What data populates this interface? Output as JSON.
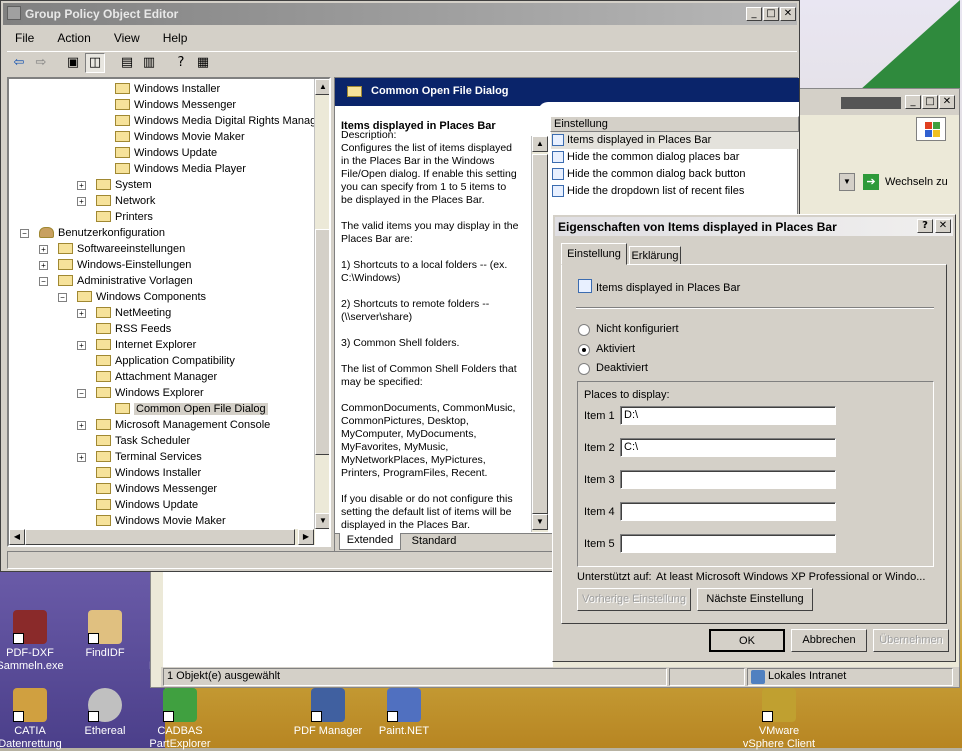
{
  "gpo_window": {
    "title": "Group Policy Object Editor",
    "menu": [
      "File",
      "Action",
      "View",
      "Help"
    ],
    "tree": [
      {
        "label": "Windows Installer",
        "indent": 4
      },
      {
        "label": "Windows Messenger",
        "indent": 4
      },
      {
        "label": "Windows Media Digital Rights Management",
        "indent": 4
      },
      {
        "label": "Windows Movie Maker",
        "indent": 4
      },
      {
        "label": "Windows Update",
        "indent": 4
      },
      {
        "label": "Windows Media Player",
        "indent": 4
      },
      {
        "label": "System",
        "indent": 3,
        "expander": "+"
      },
      {
        "label": "Network",
        "indent": 3,
        "expander": "+"
      },
      {
        "label": "Printers",
        "indent": 3
      },
      {
        "label": "Benutzerkonfiguration",
        "indent": 0,
        "expander": "-",
        "icon": "user"
      },
      {
        "label": "Softwareeinstellungen",
        "indent": 1,
        "expander": "+"
      },
      {
        "label": "Windows-Einstellungen",
        "indent": 1,
        "expander": "+"
      },
      {
        "label": "Administrative Vorlagen",
        "indent": 1,
        "expander": "-"
      },
      {
        "label": "Windows Components",
        "indent": 2,
        "expander": "-"
      },
      {
        "label": "NetMeeting",
        "indent": 3,
        "expander": "+"
      },
      {
        "label": "RSS Feeds",
        "indent": 3
      },
      {
        "label": "Internet Explorer",
        "indent": 3,
        "expander": "+"
      },
      {
        "label": "Application Compatibility",
        "indent": 3
      },
      {
        "label": "Attachment Manager",
        "indent": 3
      },
      {
        "label": "Windows Explorer",
        "indent": 3,
        "expander": "-"
      },
      {
        "label": "Common Open File Dialog",
        "indent": 4,
        "selected": true
      },
      {
        "label": "Microsoft Management Console",
        "indent": 3,
        "expander": "+"
      },
      {
        "label": "Task Scheduler",
        "indent": 3
      },
      {
        "label": "Terminal Services",
        "indent": 3,
        "expander": "+"
      },
      {
        "label": "Windows Installer",
        "indent": 3
      },
      {
        "label": "Windows Messenger",
        "indent": 3
      },
      {
        "label": "Windows Update",
        "indent": 3
      },
      {
        "label": "Windows Movie Maker",
        "indent": 3
      }
    ],
    "right_header": "Common Open File Dialog",
    "description_title": "Items displayed in Places Bar",
    "description_lines": [
      "Description:",
      "Configures the list of items displayed",
      "in the Places Bar in the Windows",
      "File/Open dialog. If enable this setting",
      "you can specify from 1 to 5 items to",
      "be displayed in the Places Bar.",
      "",
      "The valid items you may display in the",
      "Places Bar are:",
      "",
      "1) Shortcuts to a local folders -- (ex.",
      "C:\\Windows)",
      "",
      "2) Shortcuts to remote folders --",
      "(\\\\server\\share)",
      "",
      "3) Common Shell folders.",
      "",
      "The list of Common Shell Folders that",
      "may be specified:",
      "",
      "CommonDocuments, CommonMusic,",
      "CommonPictures, Desktop,",
      "MyComputer, MyDocuments,",
      "MyFavorites, MyMusic,",
      "MyNetworkPlaces, MyPictures,",
      "Printers, ProgramFiles, Recent.",
      "",
      "If you disable or do not configure this",
      "setting the default list of items will be",
      "displayed in the Places Bar."
    ],
    "list_header": "Einstellung",
    "list_items": [
      "Items displayed in Places Bar",
      "Hide the common dialog places bar",
      "Hide the common dialog back button",
      "Hide the dropdown list of recent files"
    ],
    "tabs": [
      "Extended",
      "Standard"
    ]
  },
  "dialog": {
    "title": "Eigenschaften von Items displayed in Places Bar",
    "help_glyph": "?",
    "close_glyph": "✕",
    "tabs": [
      "Einstellung",
      "Erklärung"
    ],
    "setting_name": "Items displayed in Places Bar",
    "radios": [
      {
        "label": "Nicht konfiguriert",
        "selected": false
      },
      {
        "label": "Aktiviert",
        "selected": true
      },
      {
        "label": "Deaktiviert",
        "selected": false
      }
    ],
    "group_label": "Places to display:",
    "items": [
      {
        "label": "Item 1",
        "value": "D:\\"
      },
      {
        "label": "Item 2",
        "value": "C:\\"
      },
      {
        "label": "Item 3",
        "value": ""
      },
      {
        "label": "Item 4",
        "value": ""
      },
      {
        "label": "Item 5",
        "value": ""
      }
    ],
    "supported_label": "Unterstützt auf:",
    "supported_value": "At least Microsoft Windows XP Professional or Windo...",
    "prev_button": "Vorherige Einstellung",
    "next_button": "Nächste Einstellung",
    "ok": "OK",
    "cancel": "Abbrechen",
    "apply": "Übernehmen"
  },
  "browser": {
    "go_label": "Wechseln zu",
    "status_text": "1 Objekt(e) ausgewählt",
    "zone": "Lokales Intranet"
  },
  "desktop_icons": [
    {
      "name": "pdf-dxf",
      "label1": "PDF-DXF",
      "label2": "Sammeln.exe",
      "color": "#8a2a2a"
    },
    {
      "name": "findidf",
      "label1": "FindIDF",
      "label2": "",
      "color": "#e0c080"
    },
    {
      "name": "catia",
      "label1": "CATIA",
      "label2": "Datenrettung",
      "color": "#d0a040"
    },
    {
      "name": "ethereal",
      "label1": "Ethereal",
      "label2": "",
      "color": "#c0c0c0"
    },
    {
      "name": "cadbas",
      "label1": "CADBAS",
      "label2": "PartExplorer",
      "color": "#40a040"
    },
    {
      "name": "pdf-manager",
      "label1": "PDF Manager",
      "label2": "",
      "color": "#4060a0"
    },
    {
      "name": "paint-net",
      "label1": "Paint.NET",
      "label2": "",
      "color": "#5070c0"
    },
    {
      "name": "vmware",
      "label1": "VMware",
      "label2": "vSphere Client",
      "color": "#c0a030"
    }
  ],
  "partial_label": "Pa"
}
